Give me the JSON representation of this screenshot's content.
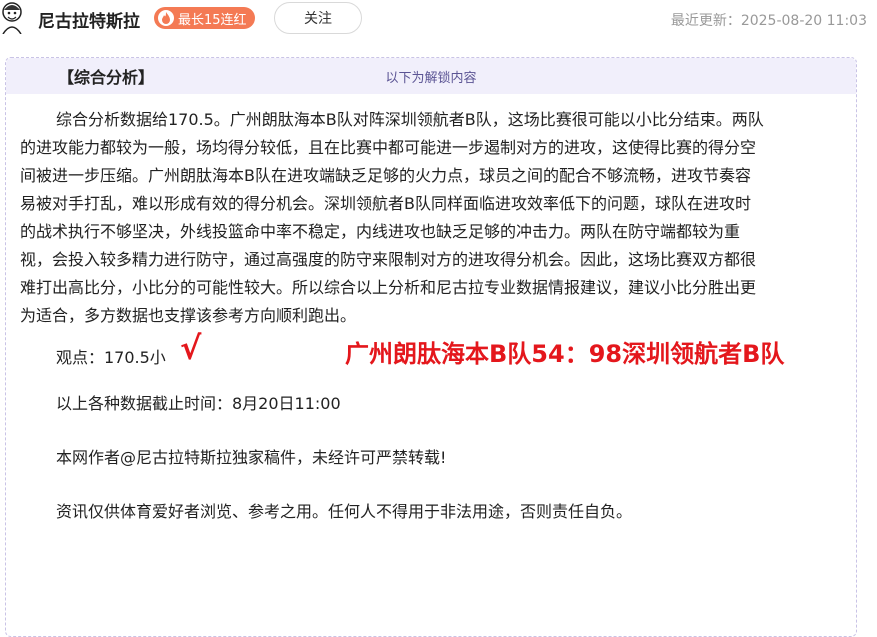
{
  "header": {
    "author_name": "尼古拉特斯拉",
    "streak_badge": "最长15连红",
    "follow_label": "关注",
    "updated_label": "最近更新：2025-08-20 11:03"
  },
  "colors": {
    "badge": "#f47a54",
    "accent_red": "#e4171c",
    "unlock_bar_bg": "#f1effb"
  },
  "card": {
    "unlock_label": "以下为解锁内容",
    "section_title": "【综合分析】",
    "analysis_lines": [
      "综合分析数据给170.5。广州朗肽海本B队对阵深圳领航者B队，这场比赛很可能以小比分结束。两队",
      "的进攻能力都较为一般，场均得分较低，且在比赛中都可能进一步遏制对方的进攻，这使得比赛的得分空",
      "间被进一步压缩。广州朗肽海本B队在进攻端缺乏足够的火力点，球员之间的配合不够流畅，进攻节奏容",
      "易被对手打乱，难以形成有效的得分机会。深圳领航者B队同样面临进攻效率低下的问题，球队在进攻时",
      "的战术执行不够坚决，外线投篮命中率不稳定，内线进攻也缺乏足够的冲击力。两队在防守端都较为重",
      "视，会投入较多精力进行防守，通过高强度的防守来限制对方的进攻得分机会。因此，这场比赛双方都很",
      "难打出高比分，小比分的可能性较大。所以综合以上分析和尼古拉专业数据情报建议，建议小比分胜出更",
      "为适合，多方数据也支撑该参考方向顺利跑出。"
    ],
    "viewpoint": "观点：170.5小",
    "check_mark": "√",
    "final_score": "广州朗肽海本B队54：98深圳领航者B队",
    "cutoff_time": "以上各种数据截止时间：8月20日11:00",
    "copyright": "本网作者@尼古拉特斯拉独家稿件，未经许可严禁转载!",
    "disclaimer": "资讯仅供体育爱好者浏览、参考之用。任何人不得用于非法用途，否则责任自负。"
  }
}
